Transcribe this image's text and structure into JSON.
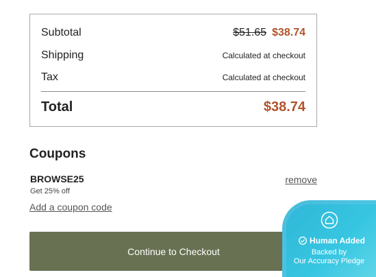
{
  "summary": {
    "subtotal_label": "Subtotal",
    "subtotal_original": "$51.65",
    "subtotal_price": "$38.74",
    "shipping_label": "Shipping",
    "shipping_value": "Calculated at checkout",
    "tax_label": "Tax",
    "tax_value": "Calculated at checkout",
    "total_label": "Total",
    "total_value": "$38.74"
  },
  "coupons": {
    "title": "Coupons",
    "applied_code": "BROWSE25",
    "applied_desc": "Get 25% off",
    "remove_label": "remove",
    "add_label": "Add a coupon code"
  },
  "checkout": {
    "button_label": "Continue to Checkout"
  },
  "badge": {
    "title": "Human Added",
    "line1": "Backed by",
    "line2": "Our Accuracy Pledge",
    "icon": "house-shield-icon"
  },
  "colors": {
    "accent_price": "#b0532b",
    "button_bg": "#687152",
    "badge_bg": "#37c6e2"
  }
}
